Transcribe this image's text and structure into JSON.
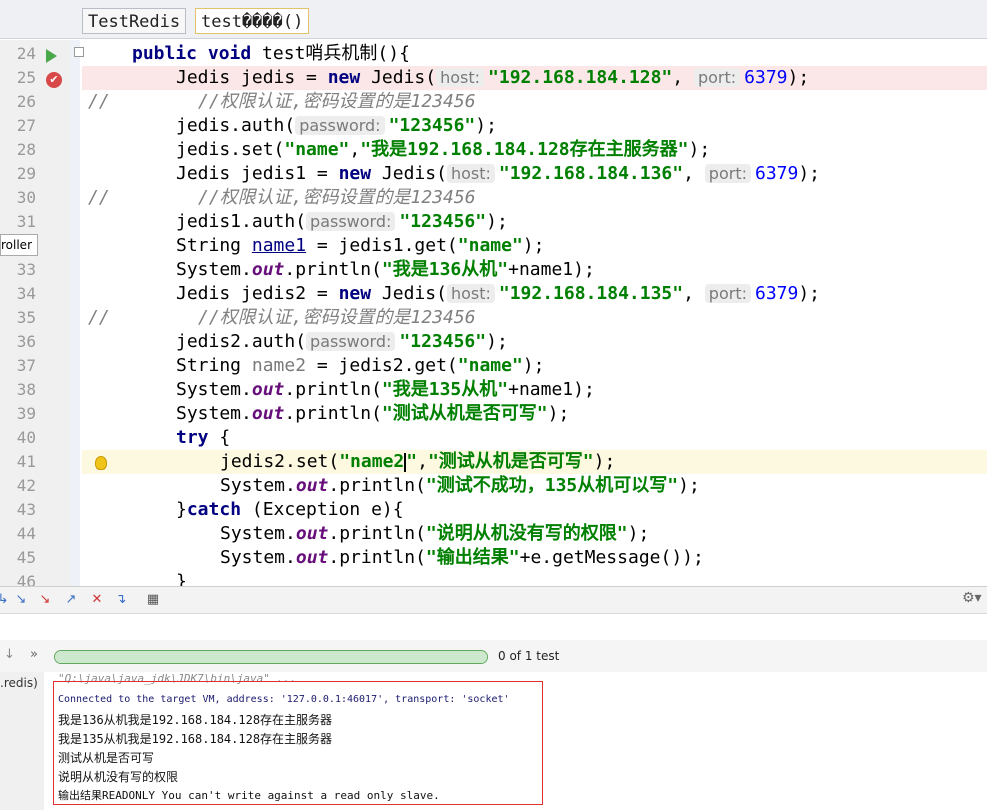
{
  "tabs": [
    {
      "label": "TestRedis"
    },
    {
      "label": "test����()"
    }
  ],
  "side_label": "roller",
  "lines": [
    {
      "num": "24"
    },
    {
      "num": "25"
    },
    {
      "num": "26"
    },
    {
      "num": "27"
    },
    {
      "num": "28"
    },
    {
      "num": "29"
    },
    {
      "num": "30"
    },
    {
      "num": "31"
    },
    {
      "num": ""
    },
    {
      "num": "33"
    },
    {
      "num": "34"
    },
    {
      "num": "35"
    },
    {
      "num": "36"
    },
    {
      "num": "37"
    },
    {
      "num": "38"
    },
    {
      "num": "39"
    },
    {
      "num": "40"
    },
    {
      "num": "41"
    },
    {
      "num": "42"
    },
    {
      "num": "43"
    },
    {
      "num": "44"
    },
    {
      "num": "45"
    },
    {
      "num": "46"
    }
  ],
  "code": {
    "l24": {
      "kw1": "public void",
      "rest": " test哨兵机制(){"
    },
    "l25": {
      "pre": "Jedis jedis = ",
      "kw": "new",
      "mid": " Jedis(",
      "hint1": "host:",
      "str1": "\"192.168.184.128\"",
      "comma": ", ",
      "hint2": "port:",
      "num": "6379",
      "end": ");"
    },
    "l26": {
      "slash": "//",
      "cmt": "//权限认证,密码设置的是123456"
    },
    "l27": {
      "pre": "jedis.auth(",
      "hint": "password:",
      "str": "\"123456\"",
      "end": ");"
    },
    "l28": {
      "pre": "jedis.set(",
      "s1": "\"name\"",
      "comma": ",",
      "s2": "\"我是192.168.184.128存在主服务器\"",
      "end": ");"
    },
    "l29": {
      "pre": "Jedis jedis1 = ",
      "kw": "new",
      "mid": " Jedis(",
      "hint1": "host:",
      "str1": "\"192.168.184.136\"",
      "comma": ", ",
      "hint2": "port:",
      "num": "6379",
      "end": ");"
    },
    "l30": {
      "slash": "//",
      "cmt": "//权限认证,密码设置的是123456"
    },
    "l31": {
      "pre": "jedis1.auth(",
      "hint": "password:",
      "str": "\"123456\"",
      "end": ");"
    },
    "l32": {
      "pre": "String ",
      "var": "name1",
      "mid": " = jedis1.get(",
      "str": "\"name\"",
      "end": ");"
    },
    "l33": {
      "pre": "System.",
      "fld": "out",
      "mid": ".println(",
      "str": "\"我是136从机\"",
      "end": "+name1);"
    },
    "l34": {
      "pre": "Jedis jedis2 = ",
      "kw": "new",
      "mid": " Jedis(",
      "hint1": "host:",
      "str1": "\"192.168.184.135\"",
      "comma": ", ",
      "hint2": "port:",
      "num": "6379",
      "end": ");"
    },
    "l35": {
      "slash": "//",
      "cmt": "//权限认证,密码设置的是123456"
    },
    "l36": {
      "pre": "jedis2.auth(",
      "hint": "password:",
      "str": "\"123456\"",
      "end": ");"
    },
    "l37": {
      "pre": "String ",
      "var": "name2",
      "mid": " = jedis2.get(",
      "str": "\"name\"",
      "end": ");"
    },
    "l38": {
      "pre": "System.",
      "fld": "out",
      "mid": ".println(",
      "str": "\"我是135从机\"",
      "end": "+name1);"
    },
    "l39": {
      "pre": "System.",
      "fld": "out",
      "mid": ".println(",
      "str": "\"测试从机是否可写\"",
      "end": ");"
    },
    "l40": {
      "kw": "try",
      "end": " {"
    },
    "l41": {
      "pre": "jedis2.set(",
      "s1a": "\"name2",
      "s1b": "\"",
      "comma": ",",
      "s2": "\"测试从机是否可写\"",
      "end": ");"
    },
    "l42": {
      "pre": "System.",
      "fld": "out",
      "mid": ".println(",
      "str": "\"测试不成功，135从机可以写\"",
      "end": ");"
    },
    "l43": {
      "pre": "}",
      "kw": "catch",
      "end": " (Exception e){"
    },
    "l44": {
      "pre": "System.",
      "fld": "out",
      "mid": ".println(",
      "str": "\"说明从机没有写的权限\"",
      "end": ");"
    },
    "l45": {
      "pre": "System.",
      "fld": "out",
      "mid": ".println(",
      "str": "\"输出结果\"",
      "end": "+e.getMessage());"
    },
    "l46": {
      "pre": "}"
    }
  },
  "run": {
    "test_count": "0 of 1 test",
    "progress": 1.0,
    "redis_label": ".redis)",
    "arrows": "»"
  },
  "console": {
    "cmd": "\"Q:\\java\\java_jdk\\JDK7\\bin\\java\" ...",
    "lines": [
      "Connected to the target VM, address: '127.0.0.1:46017', transport: 'socket'",
      "我是136从机我是192.168.184.128存在主服务器",
      "我是135从机我是192.168.184.128存在主服务器",
      "测试从机是否可写",
      "说明从机没有写的权限",
      "输出结果READONLY You can't write against a read only slave."
    ]
  },
  "colors": {
    "keyword": "#000080",
    "string": "#008000",
    "number": "#0000ff",
    "comment": "#808080",
    "error_border": "#e03030"
  }
}
